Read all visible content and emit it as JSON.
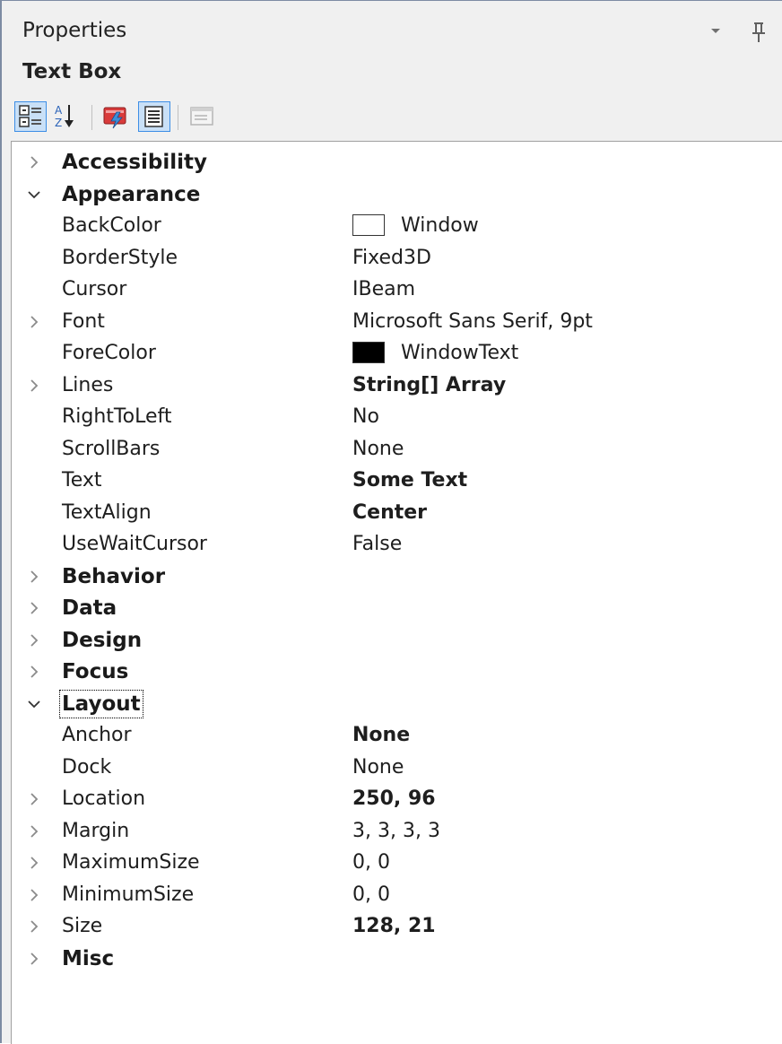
{
  "header": {
    "title": "Properties",
    "object_name": "Text Box"
  },
  "toolbar": {
    "buttons": [
      {
        "name": "categorized-view-button",
        "icon": "categorized-icon",
        "active": true
      },
      {
        "name": "alphabetical-view-button",
        "icon": "sort-az-icon",
        "active": false
      },
      {
        "name": "events-button",
        "icon": "events-lightning-icon",
        "active": false
      },
      {
        "name": "properties-button",
        "icon": "properties-list-icon",
        "active": true
      },
      {
        "name": "property-pages-button",
        "icon": "property-pages-icon",
        "active": false,
        "disabled": true
      }
    ]
  },
  "grid": {
    "rows": [
      {
        "id": "accessibility",
        "label": "Accessibility",
        "category": true,
        "expander": "collapsed",
        "value": ""
      },
      {
        "id": "appearance",
        "label": "Appearance",
        "category": true,
        "expander": "expanded",
        "value": ""
      },
      {
        "id": "backcolor",
        "label": "BackColor",
        "expander": "none",
        "value": "Window",
        "swatch": "#ffffff"
      },
      {
        "id": "borderstyle",
        "label": "BorderStyle",
        "expander": "none",
        "value": "Fixed3D"
      },
      {
        "id": "cursor",
        "label": "Cursor",
        "expander": "none",
        "value": "IBeam"
      },
      {
        "id": "font",
        "label": "Font",
        "expander": "collapsed",
        "value": "Microsoft Sans Serif, 9pt"
      },
      {
        "id": "forecolor",
        "label": "ForeColor",
        "expander": "none",
        "value": "WindowText",
        "swatch": "#000000"
      },
      {
        "id": "lines",
        "label": "Lines",
        "expander": "collapsed",
        "value": "String[] Array",
        "bold": true
      },
      {
        "id": "righttoleft",
        "label": "RightToLeft",
        "expander": "none",
        "value": "No"
      },
      {
        "id": "scrollbars",
        "label": "ScrollBars",
        "expander": "none",
        "value": "None"
      },
      {
        "id": "text",
        "label": "Text",
        "expander": "none",
        "value": "Some Text",
        "bold": true
      },
      {
        "id": "textalign",
        "label": "TextAlign",
        "expander": "none",
        "value": "Center",
        "bold": true
      },
      {
        "id": "usewaitcursor",
        "label": "UseWaitCursor",
        "expander": "none",
        "value": "False"
      },
      {
        "id": "behavior",
        "label": "Behavior",
        "category": true,
        "expander": "collapsed",
        "value": ""
      },
      {
        "id": "data",
        "label": "Data",
        "category": true,
        "expander": "collapsed",
        "value": ""
      },
      {
        "id": "design",
        "label": "Design",
        "category": true,
        "expander": "collapsed",
        "value": ""
      },
      {
        "id": "focus",
        "label": "Focus",
        "category": true,
        "expander": "collapsed",
        "value": ""
      },
      {
        "id": "layout",
        "label": "Layout",
        "category": true,
        "expander": "expanded",
        "value": "",
        "focused": true
      },
      {
        "id": "anchor",
        "label": "Anchor",
        "expander": "none",
        "value": "None",
        "bold": true
      },
      {
        "id": "dock",
        "label": "Dock",
        "expander": "none",
        "value": "None"
      },
      {
        "id": "location",
        "label": "Location",
        "expander": "collapsed",
        "value": "250, 96",
        "bold": true
      },
      {
        "id": "margin",
        "label": "Margin",
        "expander": "collapsed",
        "value": "3, 3, 3, 3"
      },
      {
        "id": "maximumsize",
        "label": "MaximumSize",
        "expander": "collapsed",
        "value": "0, 0"
      },
      {
        "id": "minimumsize",
        "label": "MinimumSize",
        "expander": "collapsed",
        "value": "0, 0"
      },
      {
        "id": "size",
        "label": "Size",
        "expander": "collapsed",
        "value": "128, 21",
        "bold": true
      },
      {
        "id": "misc",
        "label": "Misc",
        "category": true,
        "expander": "collapsed",
        "value": ""
      }
    ]
  }
}
